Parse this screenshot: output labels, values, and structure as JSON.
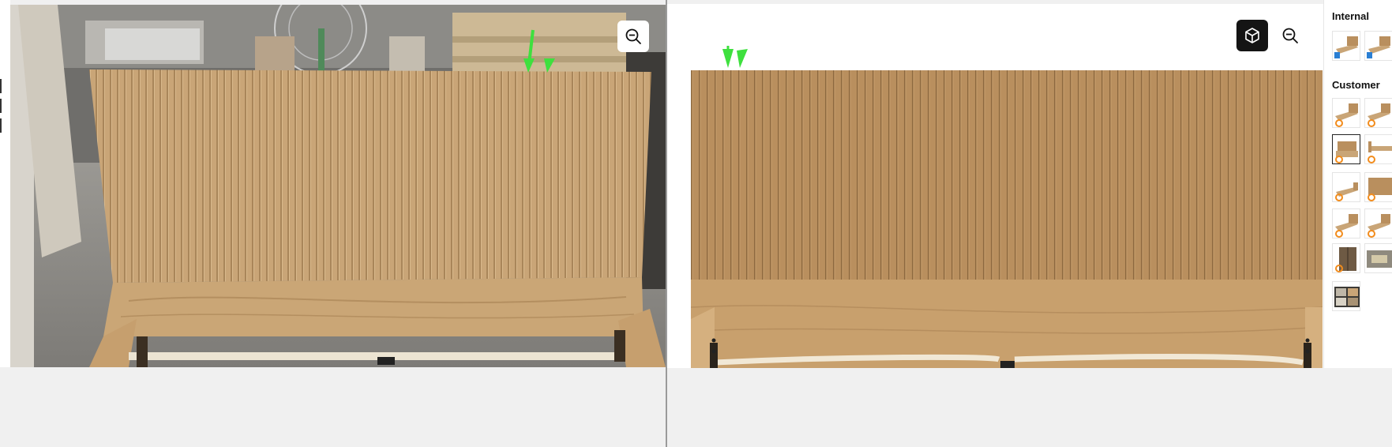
{
  "sidebar": {
    "internal_heading": "Internal",
    "customer_heading": "Customer",
    "internal_thumbs": [
      {
        "name": "internal-thumb-1",
        "badge": "blue"
      },
      {
        "name": "internal-thumb-2",
        "badge": "blue"
      }
    ],
    "customer_thumbs": [
      {
        "name": "customer-thumb-1",
        "selected": false
      },
      {
        "name": "customer-thumb-2",
        "selected": false
      },
      {
        "name": "customer-thumb-3",
        "selected": true
      },
      {
        "name": "customer-thumb-4",
        "selected": false
      },
      {
        "name": "customer-thumb-5",
        "selected": false
      },
      {
        "name": "customer-thumb-6",
        "selected": false
      },
      {
        "name": "customer-thumb-7",
        "selected": false
      },
      {
        "name": "customer-thumb-8",
        "selected": false
      },
      {
        "name": "customer-thumb-9",
        "selected": false
      },
      {
        "name": "customer-thumb-10",
        "selected": false
      },
      {
        "name": "customer-thumb-11",
        "selected": false
      }
    ]
  },
  "icons": {
    "zoom_out_left": "zoom-out-icon",
    "zoom_out_right": "zoom-out-icon",
    "view_3d": "cube-icon"
  },
  "colors": {
    "wood_light": "#c9a577",
    "wood_render": "#b98f5e",
    "annotation_arrow": "#3ee03e",
    "badge_orange": "#f28c1c",
    "badge_blue": "#2a7fd4",
    "active_button": "#141414"
  }
}
